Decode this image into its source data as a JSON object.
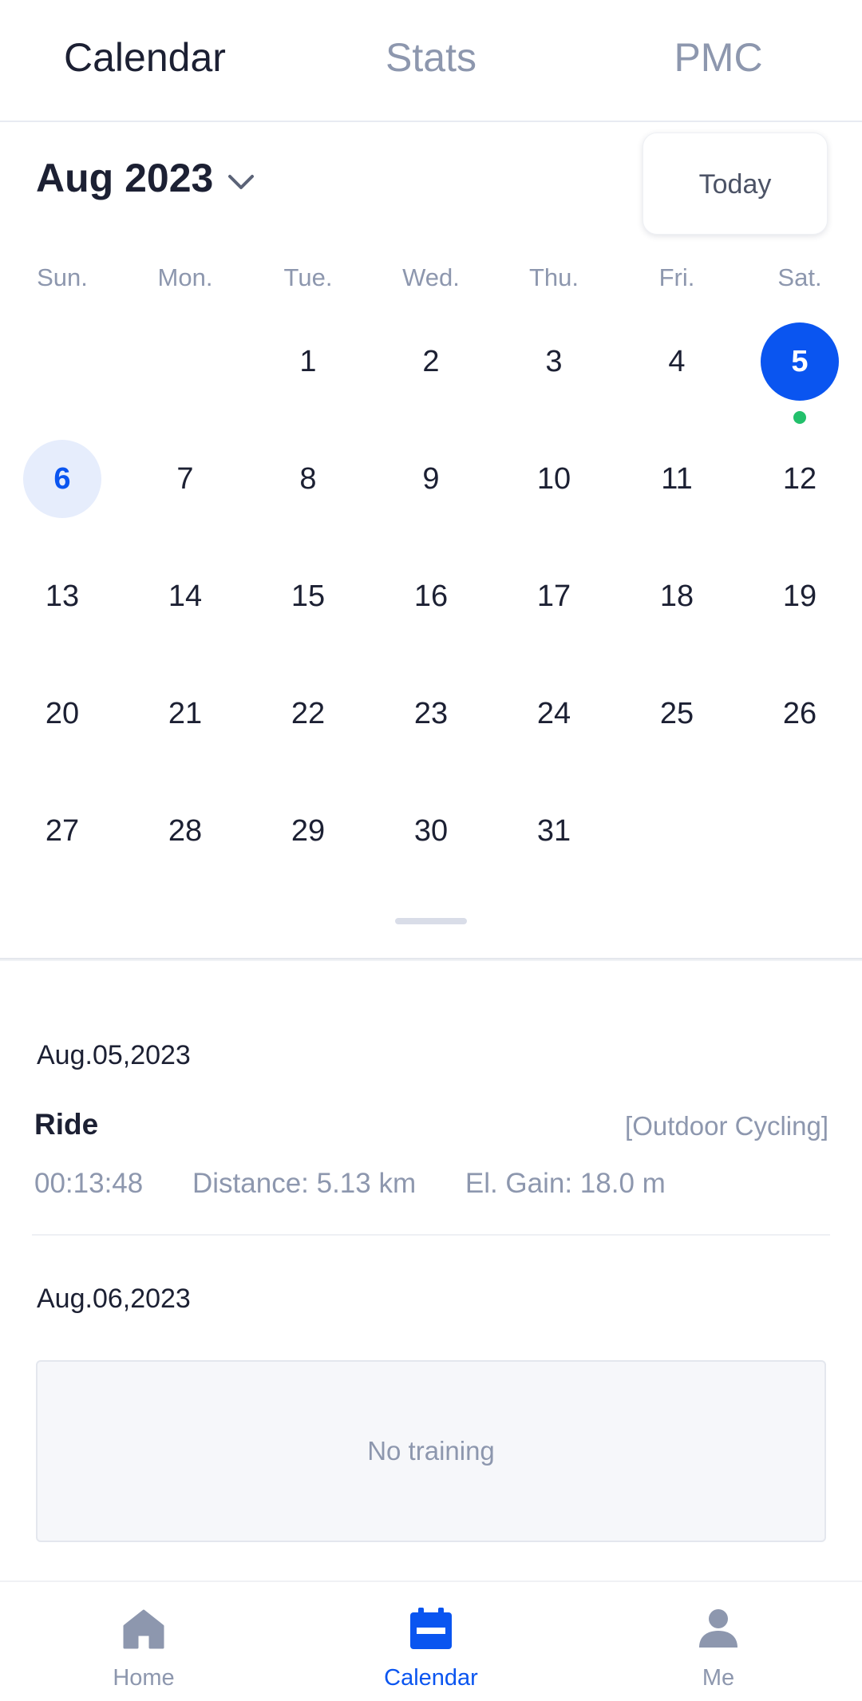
{
  "top_tabs": [
    {
      "label": "Calendar",
      "active": true
    },
    {
      "label": "Stats",
      "active": false
    },
    {
      "label": "PMC",
      "active": false
    }
  ],
  "month": {
    "title": "Aug 2023",
    "dropdown_icon": "chevron-down-icon"
  },
  "today_button": "Today",
  "weekdays": [
    "Sun.",
    "Mon.",
    "Tue.",
    "Wed.",
    "Thu.",
    "Fri.",
    "Sat."
  ],
  "calendar": {
    "first_weekday_index": 2,
    "days_in_month": 31,
    "selected_day": 5,
    "today": 6,
    "activity_days": [
      5
    ],
    "selected_color": "#0a55f0",
    "today_bg_color": "#e6edfc",
    "activity_dot_color": "#22c06b"
  },
  "entries": [
    {
      "date": "Aug.05,2023",
      "activity": {
        "name": "Ride",
        "type": "[Outdoor Cycling]",
        "duration": "00:13:48",
        "distance": "Distance: 5.13 km",
        "elevation": "El. Gain: 18.0 m"
      }
    },
    {
      "date": "Aug.06,2023",
      "empty_text": "No training"
    }
  ],
  "bottom_nav": [
    {
      "label": "Home",
      "icon": "home-icon",
      "active": false
    },
    {
      "label": "Calendar",
      "icon": "calendar-icon",
      "active": true
    },
    {
      "label": "Me",
      "icon": "user-icon",
      "active": false
    }
  ]
}
